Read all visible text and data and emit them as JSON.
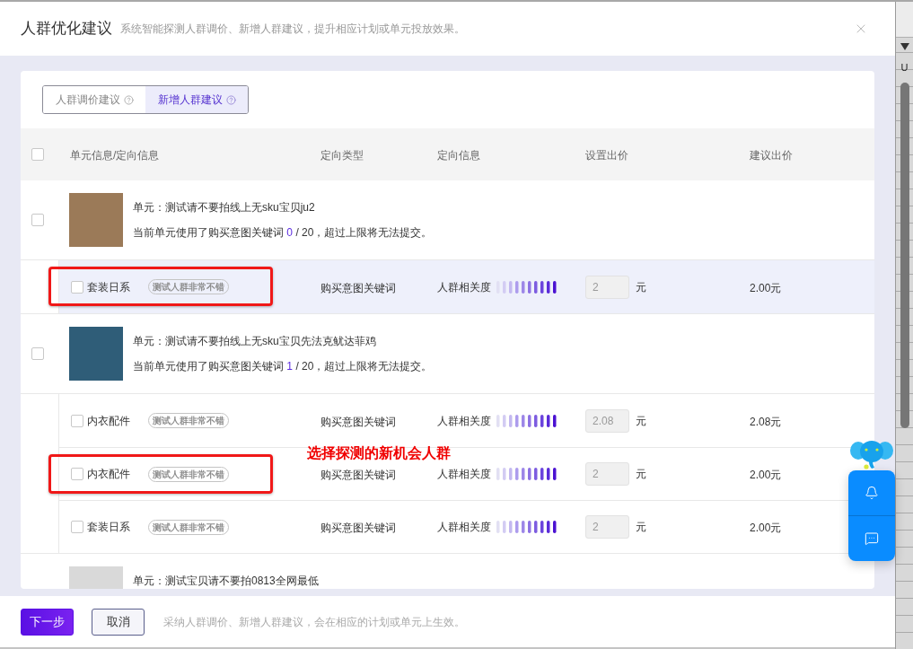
{
  "dialog": {
    "title": "人群优化建议",
    "subtitle": "系统智能探测人群调价、新增人群建议，提升相应计划或单元投放效果。"
  },
  "tabs": [
    {
      "label": "人群调价建议",
      "selected": false
    },
    {
      "label": "新增人群建议",
      "selected": true
    }
  ],
  "table": {
    "select_all": {
      "checked": false
    },
    "columns": [
      "单元信息/定向信息",
      "定向类型",
      "定向信息",
      "设置出价",
      "建议出价"
    ],
    "units": [
      {
        "checked": false,
        "title": "单元：测试请不要拍线上无sku宝贝ju2",
        "usage_prefix": "当前单元使用了购买意图关键词",
        "usage_count": "0",
        "usage_suffix": "/ 20，超过上限将无法提交。",
        "audiences": [
          {
            "checked": false,
            "highlighted": true,
            "annotated": true,
            "name": "套装日系",
            "tag": "测试人群非常不错",
            "type": "购买意图关键词",
            "relevance_label": "人群相关度",
            "bid": "2",
            "bid_unit": "元",
            "suggested_bid": "2.00元"
          }
        ]
      },
      {
        "checked": false,
        "title": "单元：测试请不要拍线上无sku宝贝先法克鱿达菲鸡",
        "usage_prefix": "当前单元使用了购买意图关键词",
        "usage_count": "1",
        "usage_suffix": "/ 20，超过上限将无法提交。",
        "audiences": [
          {
            "checked": false,
            "highlighted": false,
            "annotated": false,
            "name": "内衣配件",
            "tag": "测试人群非常不错",
            "type": "购买意图关键词",
            "relevance_label": "人群相关度",
            "bid": "2.08",
            "bid_unit": "元",
            "suggested_bid": "2.08元"
          },
          {
            "checked": false,
            "highlighted": false,
            "annotated": true,
            "callout": "选择探测的新机会人群",
            "name": "内衣配件",
            "tag": "测试人群非常不错",
            "type": "购买意图关键词",
            "relevance_label": "人群相关度",
            "bid": "2",
            "bid_unit": "元",
            "suggested_bid": "2.00元"
          },
          {
            "checked": false,
            "highlighted": false,
            "annotated": false,
            "name": "套装日系",
            "tag": "测试人群非常不错",
            "type": "购买意图关键词",
            "relevance_label": "人群相关度",
            "bid": "2",
            "bid_unit": "元",
            "suggested_bid": "2.00元"
          }
        ]
      },
      {
        "title": "单元：测试宝贝请不要拍0813全网最低"
      }
    ]
  },
  "footer": {
    "buttons": [
      {
        "label": "下一步",
        "kind": "primary"
      },
      {
        "label": "取消",
        "kind": "secondary"
      }
    ],
    "hint": "采纳人群调价、新增人群建议，会在相应的计划或单元上生效。"
  },
  "spreadsheet_edge": {
    "column_label": "U"
  }
}
